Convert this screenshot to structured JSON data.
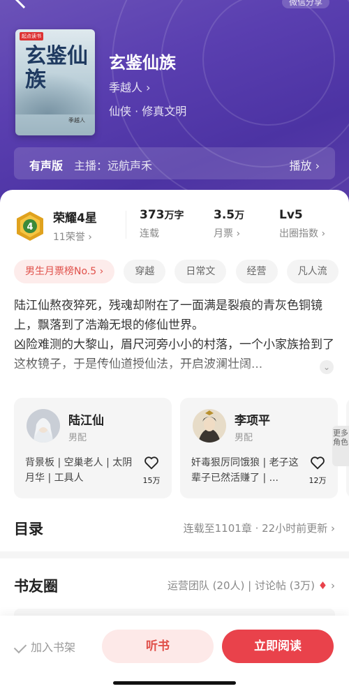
{
  "header": {
    "share_label": "微信分享",
    "cover": {
      "badge": "起点读书",
      "title": "玄鉴仙族",
      "author": "季越人"
    },
    "title": "玄鉴仙族",
    "author": "季越人",
    "genre": "仙侠 · 修真文明",
    "audio": {
      "label": "有声版",
      "host": "主播：远航声禾",
      "play": "播放"
    }
  },
  "stats": {
    "honor": {
      "level": "4",
      "title": "荣耀4星",
      "sub": "11荣誉"
    },
    "words": {
      "value": "373",
      "unit": "万字",
      "label": "连载"
    },
    "tickets": {
      "value": "3.5",
      "unit": "万",
      "label": "月票"
    },
    "circle": {
      "value": "Lv5",
      "label": "出圈指数"
    }
  },
  "tags": [
    "男生月票榜No.5",
    "穿越",
    "日常文",
    "经营",
    "凡人流"
  ],
  "synopsis": {
    "p1": "陆江仙熬夜猝死，残魂却附在了一面满是裂痕的青灰色铜镜上，飘落到了浩瀚无垠的修仙世界。",
    "p2": "凶险难测的大黎山，眉尺河旁小小的村落，一个小家族拾到了这枚镜子，于是传仙道授仙法，开启波澜壮阔..."
  },
  "characters": [
    {
      "name": "陆江仙",
      "role": "男配",
      "desc": "背景板 | 空巢老人 | 太阴月华 | 工具人",
      "likes": "15万"
    },
    {
      "name": "李项平",
      "role": "男配",
      "desc": "奸毒狠厉同饿狼 | 老子这辈子已然活赚了 | ...",
      "likes": "12万"
    }
  ],
  "more_roles": "更多角色",
  "catalog": {
    "title": "目录",
    "meta": "连载至1101章 · 22小时前更新"
  },
  "circle_section": {
    "title": "书友圈",
    "meta": "运营团队 (20人) | 讨论帖 (3万)"
  },
  "bottom": {
    "shelf": "加入书架",
    "listen": "听书",
    "read": "立即阅读"
  },
  "colors": {
    "accent": "#e9424b",
    "header_bg": "#5a3fb0",
    "rank_chip": "#e0504a"
  }
}
